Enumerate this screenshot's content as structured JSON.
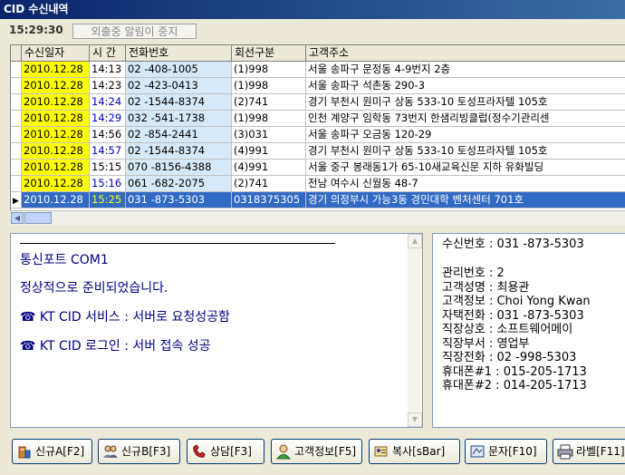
{
  "window": {
    "title": "CID 수신내역"
  },
  "toolbar": {
    "clock": "15:29:30",
    "away_button": "외출중 알림이 중지"
  },
  "table": {
    "headers": [
      "수신일자",
      "시 간",
      "전화번호",
      "회선구분",
      "고객주소"
    ],
    "rows": [
      {
        "date": "2010.12.28",
        "time": "14:13",
        "phone": "02  -408-1005",
        "line": "(1)998",
        "addr": "서울 송파구 문정동 4-9번지 2층"
      },
      {
        "date": "2010.12.28",
        "time": "14:23",
        "phone": "02  -423-0413",
        "line": "(1)998",
        "addr": "서울 송파구 석촌동 290-3"
      },
      {
        "date": "2010.12.28",
        "time": "14:24",
        "phone": "02  -1544-8374",
        "line": "(2)741",
        "addr": "경기 부천시 원미구 상동 533-10 토성프라자텔 105호"
      },
      {
        "date": "2010.12.28",
        "time": "14:29",
        "phone": "032 -541-1738",
        "line": "(1)998",
        "addr": "인천 계양구 임학동 73번지 한샘리빙클럽(정수기관리센"
      },
      {
        "date": "2010.12.28",
        "time": "14:56",
        "phone": "02  -854-2441",
        "line": "(3)031",
        "addr": "서울 송파구 오금동 120-29"
      },
      {
        "date": "2010.12.28",
        "time": "14:57",
        "phone": "02  -1544-8374",
        "line": "(4)991",
        "addr": "경기 부천시 원미구 상동 533-10 토성프라자텔 105호"
      },
      {
        "date": "2010.12.28",
        "time": "15:15",
        "phone": "070 -8156-4388",
        "line": "(4)991",
        "addr": "서울 중구 봉래동1가 65-10새교육신문 지하 유화빌딩"
      },
      {
        "date": "2010.12.28",
        "time": "15:16",
        "phone": "061 -682-2075",
        "line": "(2)741",
        "addr": "전남 여수시 신월동 48-7"
      },
      {
        "date": "2010.12.28",
        "time": "15:25",
        "phone": "031 -873-5303",
        "line": "0318375305",
        "addr": "경기 의정부시 가능3동 경민대학 벤처센터 701호"
      }
    ]
  },
  "log": {
    "lines": [
      "통신포트 COM1",
      "정상적으로 준비되었습니다.",
      "☎ KT CID 서비스 : 서버로 요청성공함",
      "☎ KT CID 로그인 : 서버 접속 성공"
    ]
  },
  "info": {
    "received": "수신번호 : 031 -873-5303",
    "fields": [
      "관리번호 : 2",
      "고객성명 : 최용관",
      "고객정보 : Choi Yong Kwan",
      "자택전화 : 031 -873-5303",
      "직장상호 : 소프트웨어메이",
      "직장부서 : 영업부",
      "직장전화 : 02  -998-5303",
      "휴대폰#1 : 015-205-1713",
      "휴대폰#2 : 014-205-1713"
    ]
  },
  "buttons": [
    "신규A[F2]",
    "신규B[F3]",
    "상담[F3]",
    "고객정보[F5]",
    "복사[sBar]",
    "문자[F10]",
    "라벨[F11]"
  ],
  "colors": {
    "date_bg": "#ffff00",
    "phone_bg": "#d6e9f8",
    "selection": "#316ac5",
    "log_text": "#000080"
  }
}
